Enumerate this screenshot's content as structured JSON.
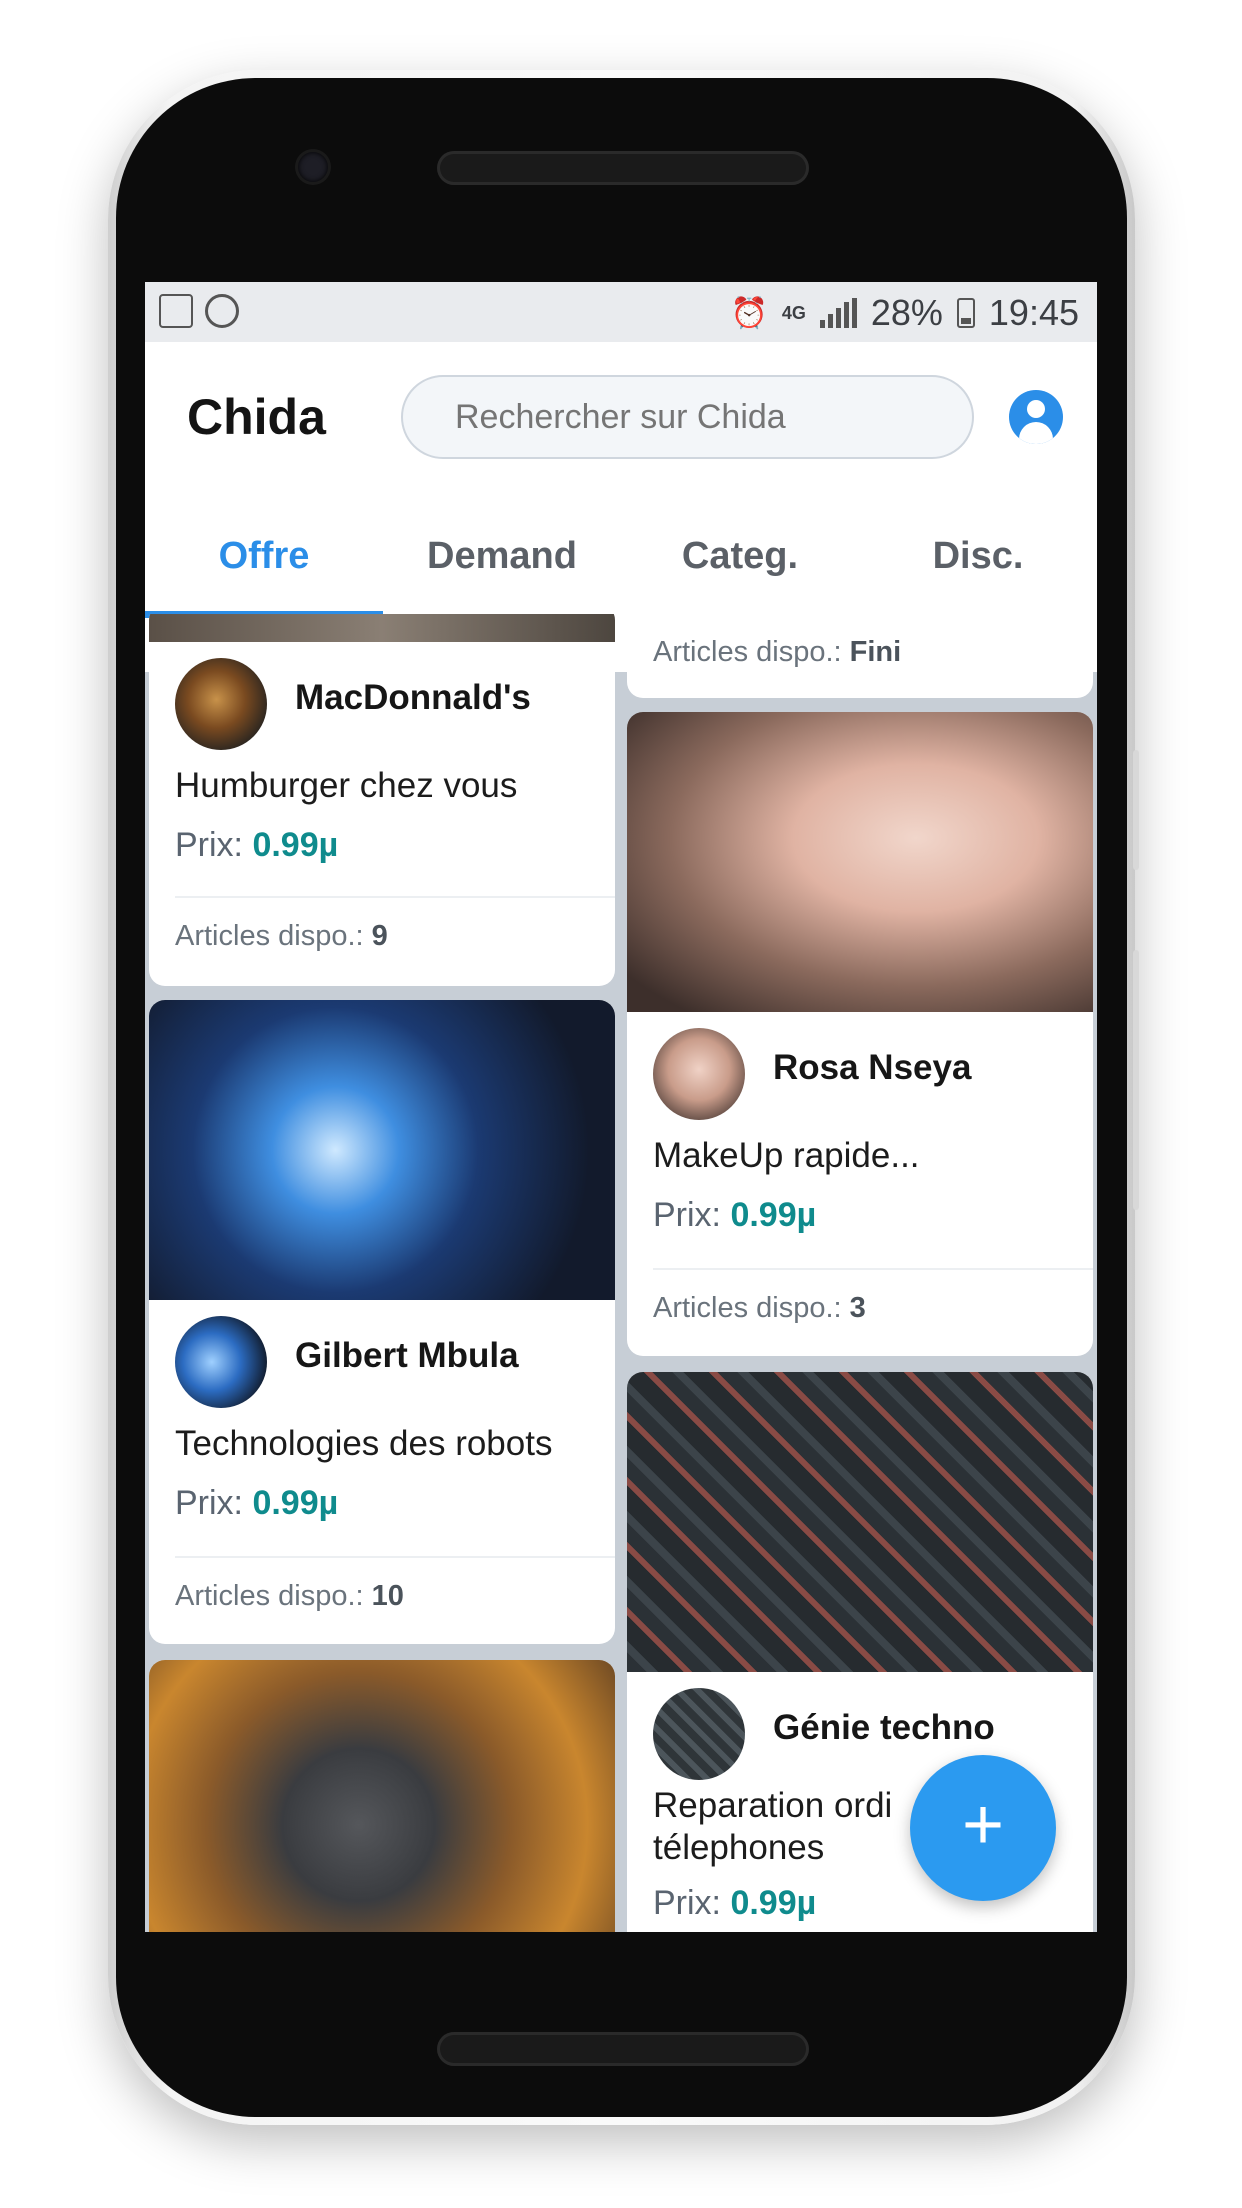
{
  "status_bar": {
    "left_icons": [
      "news-app-icon",
      "whatsapp-icon"
    ],
    "right_icons": [
      "alarm-icon",
      "4g-icon",
      "signal-icon",
      "battery-icon"
    ],
    "battery": "28%",
    "time": "19:45"
  },
  "app": {
    "title": "Chida",
    "search_placeholder": "Rechercher sur Chida",
    "account_icon": "account-circle-icon"
  },
  "tabs": [
    {
      "label": "Offre",
      "active": true
    },
    {
      "label": "Demand",
      "active": false
    },
    {
      "label": "Categ.",
      "active": false
    },
    {
      "label": "Disc.",
      "active": false
    }
  ],
  "cards": [
    {
      "author": "MacDonnald's",
      "title": "Humburger chez vous",
      "price_label": "Prix:",
      "price": "0.99µ",
      "stock_label": "Articles dispo.:",
      "stock": "9"
    },
    {
      "stock_label": "Articles dispo.:",
      "stock": "Fini"
    },
    {
      "author": "Rosa Nseya",
      "title": "MakeUp rapide...",
      "price_label": "Prix:",
      "price": "0.99µ",
      "stock_label": "Articles dispo.:",
      "stock": "3"
    },
    {
      "author": "Gilbert Mbula",
      "title": "Technologies des robots",
      "price_label": "Prix:",
      "price": "0.99µ",
      "stock_label": "Articles dispo.:",
      "stock": "10"
    },
    {
      "author": "Génie techno",
      "title_line1": "Reparation ordi",
      "title_line2": "télephones",
      "price_label": "Prix:",
      "price": "0.99µ"
    }
  ],
  "fab": {
    "label": "+",
    "icon": "plus-icon"
  },
  "colors": {
    "accent": "#2b8ee8",
    "price": "#0f8b8d",
    "feed_background": "#c7ced6"
  }
}
